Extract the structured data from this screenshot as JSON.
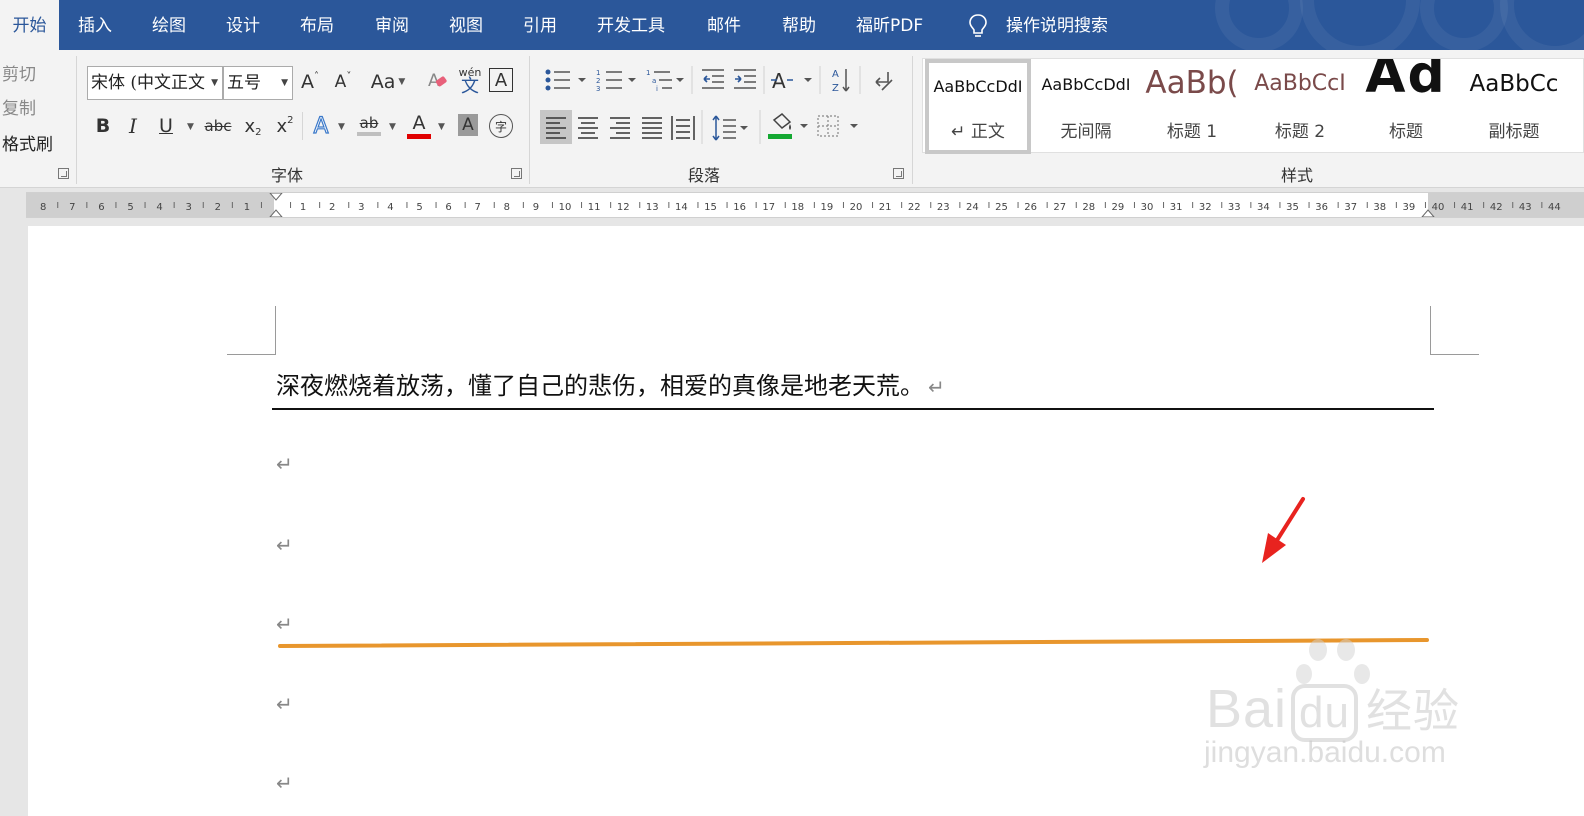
{
  "tabs": [
    {
      "label": "开始",
      "active": true
    },
    {
      "label": "插入"
    },
    {
      "label": "绘图"
    },
    {
      "label": "设计"
    },
    {
      "label": "布局"
    },
    {
      "label": "审阅"
    },
    {
      "label": "视图"
    },
    {
      "label": "引用"
    },
    {
      "label": "开发工具"
    },
    {
      "label": "邮件"
    },
    {
      "label": "帮助"
    },
    {
      "label": "福昕PDF"
    }
  ],
  "tell_me": {
    "label": "操作说明搜索",
    "icon": "lightbulb-icon"
  },
  "clipboard": {
    "cut": "剪切",
    "copy": "复制",
    "format_painter": "格式刷"
  },
  "font_group": {
    "label": "字体",
    "font_name": "宋体 (中文正文",
    "font_size": "五号",
    "change_case": "Aa",
    "phonetic_top": "wén",
    "phonetic_bottom": "文",
    "char_border": "A",
    "bold": "B",
    "italic": "I",
    "underline": "U",
    "strike": "abc",
    "subscript": "x",
    "sub_mark": "2",
    "superscript": "x",
    "sup_mark": "2",
    "text_effect": "A",
    "highlight": "ab",
    "font_color": "A",
    "char_shading": "A",
    "enclose": "字",
    "grow": "A",
    "shrink": "A"
  },
  "paragraph_group": {
    "label": "段落",
    "sort": "AZ"
  },
  "styles_group": {
    "label": "样式",
    "items": [
      {
        "preview": "AaBbCcDdI",
        "name": "↵ 正文",
        "selected": true
      },
      {
        "preview": "AaBbCcDdI",
        "name": "无间隔"
      },
      {
        "preview": "AaBb(",
        "name": "标题 1"
      },
      {
        "preview": "AaBbCcI",
        "name": "标题 2"
      },
      {
        "preview": "Ad",
        "name": "标题"
      },
      {
        "preview": "AaBbCc",
        "name": "副标题"
      }
    ]
  },
  "ruler": {
    "left_ticks": [
      "8",
      "7",
      "6",
      "5",
      "4",
      "3",
      "2",
      "1"
    ],
    "right_max": 44
  },
  "document": {
    "line1": "深夜燃烧着放荡，懂了自己的悲伤，相爱的真像是地老天荒。",
    "para_mark": "↵"
  },
  "colors": {
    "tab_bar": "#2b579a",
    "orange_line": "#e8962d",
    "arrow": "#e8231f",
    "font_color_bar": "#e00000",
    "shading_bar": "#14a832"
  },
  "watermark": {
    "logo_left": "Bai",
    "logo_mid": "du",
    "logo_right": "经验",
    "url": "jingyan.baidu.com"
  }
}
